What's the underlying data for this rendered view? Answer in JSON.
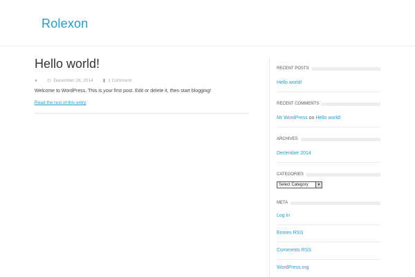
{
  "site": {
    "title": "Rolexon"
  },
  "post": {
    "title": "Hello world!",
    "date": "December 28, 2014",
    "comments": "1 Comment",
    "body": "Welcome to WordPress. This is your first post. Edit or delete it, then start blogging!",
    "read_more": "Read the rest of this entry"
  },
  "sidebar": {
    "recent_posts": {
      "heading": "RECENT POSTS",
      "items": [
        "Hello world!"
      ]
    },
    "recent_comments": {
      "heading": "RECENT COMMENTS",
      "author": "Mr WordPress",
      "on_text": "on",
      "post": "Hello world!"
    },
    "archives": {
      "heading": "ARCHIVES",
      "items": [
        "December 2014"
      ]
    },
    "categories": {
      "heading": "CATEGORIES",
      "select_value": "Select Category"
    },
    "meta": {
      "heading": "META",
      "items": [
        "Log in",
        "Entries RSS",
        "Comments RSS",
        "WordPress.org"
      ]
    }
  },
  "colors": {
    "accent": "#1e9ed1"
  },
  "icons": {
    "author": "user-icon",
    "date": "clock-icon",
    "comments": "comments-icon"
  }
}
